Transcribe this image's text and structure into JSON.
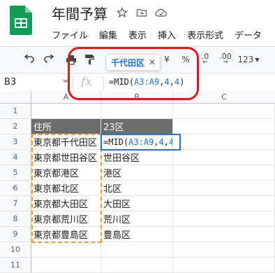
{
  "app": {
    "title": "年間予算",
    "menu": [
      "ファイル",
      "編集",
      "表示",
      "挿入",
      "表示形式",
      "データ"
    ]
  },
  "toolbar": {
    "currency": "¥",
    "percent": "%",
    "decimal_dec": ".0",
    "decimal_inc": ".00",
    "format_123": "123"
  },
  "chip": {
    "label": "千代田区"
  },
  "formula_bar": {
    "name_box": "B3",
    "fx": "fx",
    "formula_prefix": "=MID(",
    "formula_ref": "A3:A9",
    "formula_sep1": ",",
    "formula_arg1": "4",
    "formula_sep2": ",",
    "formula_arg2": "4",
    "formula_suffix": ")"
  },
  "grid": {
    "columns": [
      "A",
      "B",
      "C"
    ],
    "rows": [
      "1",
      "2",
      "3",
      "4",
      "5",
      "6",
      "7",
      "8",
      "9",
      "10",
      "11"
    ],
    "header_row": {
      "a": "住所",
      "b": "23区"
    },
    "data": [
      {
        "a": "東京都千代田区",
        "b": "=MID(A3:A9,4,4)"
      },
      {
        "a": "東京都世田谷区",
        "b": "世田谷区"
      },
      {
        "a": "東京都港区",
        "b": "港区"
      },
      {
        "a": "東京都北区",
        "b": "北区"
      },
      {
        "a": "東京都大田区",
        "b": "大田区"
      },
      {
        "a": "東京都荒川区",
        "b": "荒川区"
      },
      {
        "a": "東京都豊島区",
        "b": "豊島区"
      }
    ]
  },
  "colors": {
    "header_fill": "#6d6d6d",
    "active_border": "#1a73e8",
    "range_dash": "#f5a12d",
    "highlight_ring": "#e8141b"
  }
}
